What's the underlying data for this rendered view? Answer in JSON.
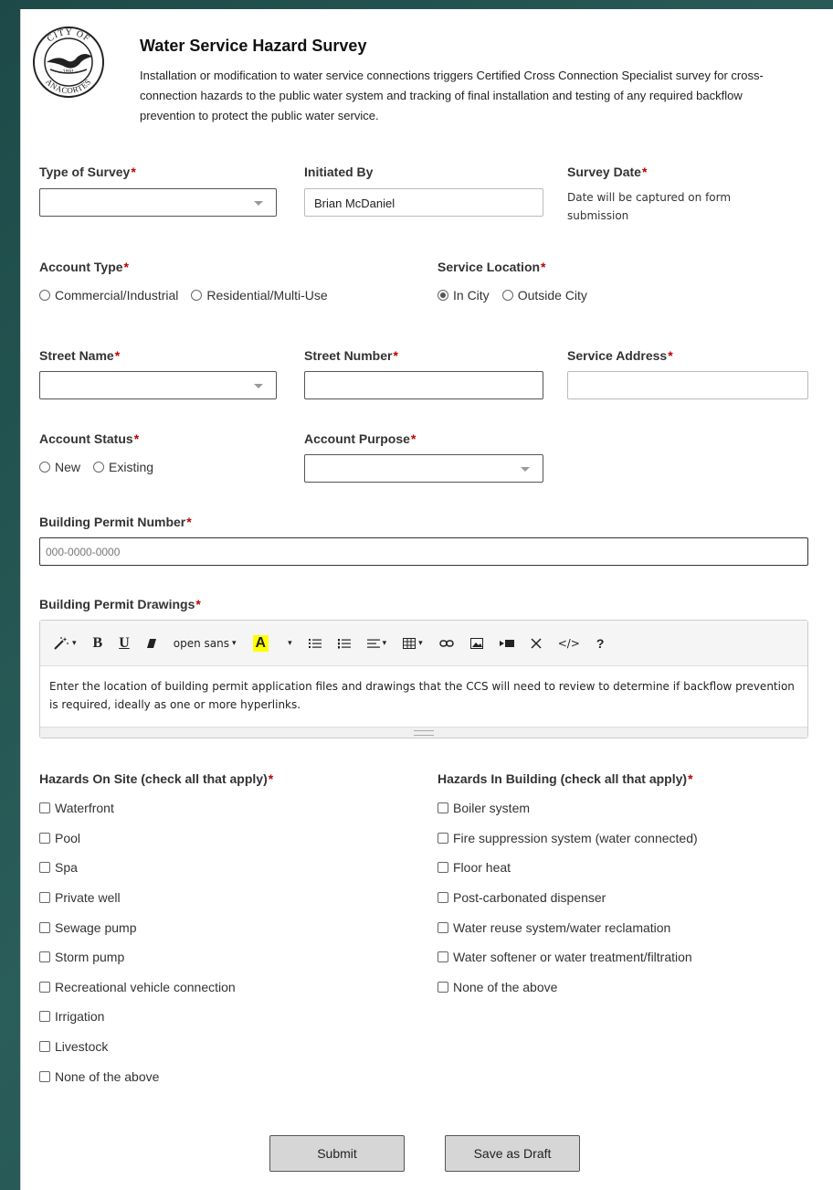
{
  "header": {
    "logo_text_top": "CITY OF",
    "logo_text_bottom": "ANACORTES",
    "logo_year": "1891",
    "title": "Water Service Hazard Survey",
    "description": "Installation or modification to water service connections triggers Certified Cross Connection Specialist survey for cross-connection hazards to the public water system and tracking of final installation and testing of any required backflow prevention to protect the public water service."
  },
  "fields": {
    "type_of_survey": {
      "label": "Type of Survey",
      "value": ""
    },
    "initiated_by": {
      "label": "Initiated By",
      "value": "Brian McDaniel"
    },
    "survey_date": {
      "label": "Survey Date",
      "note": "Date will be captured on form submission"
    },
    "account_type": {
      "label": "Account Type",
      "options": [
        "Commercial/Industrial",
        "Residential/Multi-Use"
      ]
    },
    "service_location": {
      "label": "Service Location",
      "options": [
        "In City",
        "Outside City"
      ],
      "selected": "In City"
    },
    "street_name": {
      "label": "Street Name",
      "value": ""
    },
    "street_number": {
      "label": "Street Number",
      "value": ""
    },
    "service_address": {
      "label": "Service Address",
      "value": ""
    },
    "account_status": {
      "label": "Account Status",
      "options": [
        "New",
        "Existing"
      ]
    },
    "account_purpose": {
      "label": "Account Purpose",
      "value": ""
    },
    "building_permit_number": {
      "label": "Building Permit Number",
      "placeholder": "000-0000-0000"
    },
    "building_permit_drawings": {
      "label": "Building Permit Drawings",
      "font_name": "open sans",
      "text": "Enter the location of building permit application files and drawings that the CCS will need to review to determine if backflow prevention is required, ideally as one or more hyperlinks."
    },
    "required_marker": "*"
  },
  "hazards_on_site": {
    "label": "Hazards On Site (check all that apply)",
    "items": [
      "Waterfront",
      "Pool",
      "Spa",
      "Private well",
      "Sewage pump",
      "Storm pump",
      "Recreational vehicle connection",
      "Irrigation",
      "Livestock",
      "None of the above"
    ]
  },
  "hazards_in_building": {
    "label": "Hazards In Building (check all that apply)",
    "items": [
      "Boiler system",
      "Fire suppression system (water connected)",
      "Floor heat",
      "Post-carbonated dispenser",
      "Water reuse system/water reclamation",
      "Water softener or water treatment/filtration",
      "None of the above"
    ]
  },
  "buttons": {
    "submit": "Submit",
    "save_draft": "Save as Draft"
  },
  "colors": {
    "background": "#1d4a48",
    "required": "#bb0000",
    "button": "#d6d6d6",
    "highlight": "#ffff00"
  }
}
